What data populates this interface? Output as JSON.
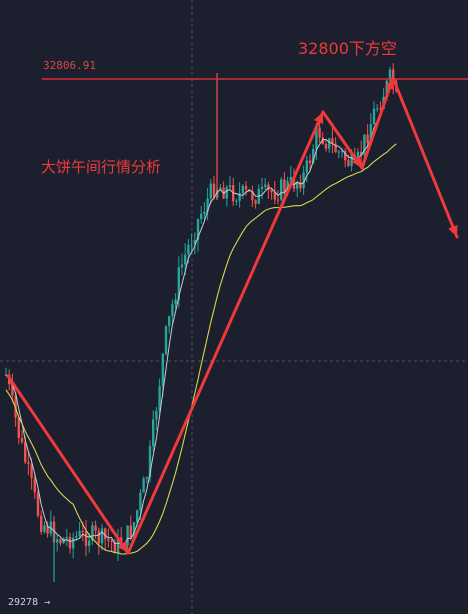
{
  "chart_data": {
    "type": "candlestick",
    "resistance_level": "32806.91",
    "low_label": "29278 →",
    "annotations": [
      "32800下方空",
      "大饼午间行情分析"
    ],
    "colors": {
      "background": "#1b1f2e",
      "up": "#26a69a",
      "down": "#ef5350",
      "ma_fast": "#c9c9d6",
      "ma_slow": "#d6d64a",
      "resistance_line": "#d62f3a",
      "arrow": "#ee3a3a",
      "grid": "#4a5064"
    },
    "series": [
      {
        "type": "ma",
        "color_key": "ma_fast"
      },
      {
        "type": "ma",
        "color_key": "ma_slow"
      }
    ],
    "price_range": [
      29278,
      32806.91
    ]
  }
}
